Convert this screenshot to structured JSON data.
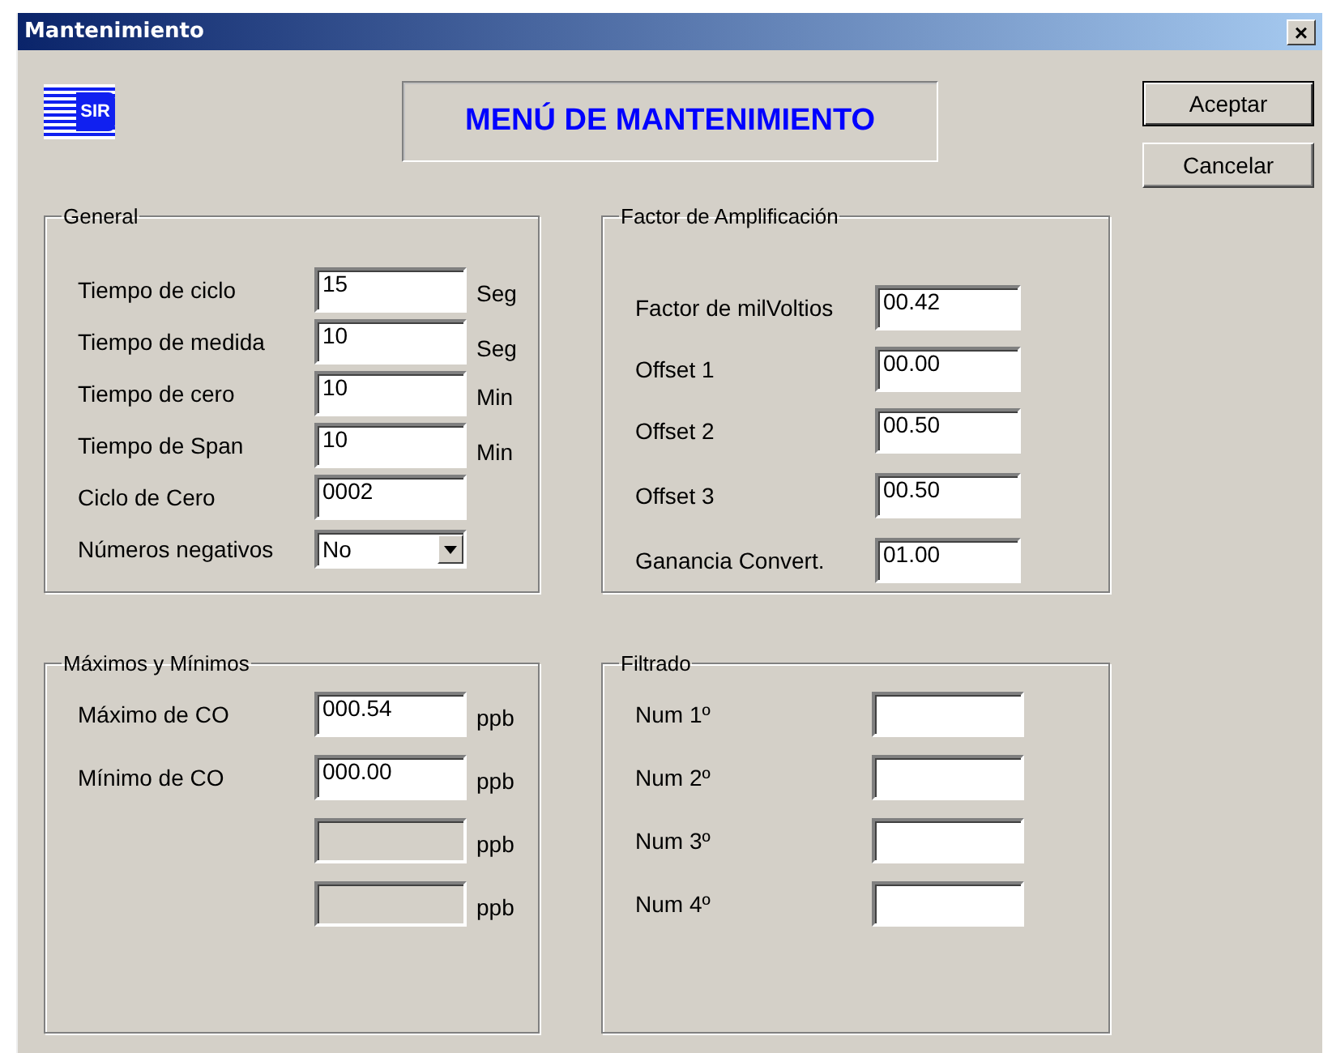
{
  "window": {
    "title": "Mantenimiento",
    "close": "×"
  },
  "logo": {
    "text": "SIR"
  },
  "heading": "MENÚ DE MANTENIMIENTO",
  "buttons": [
    {
      "label": "Aceptar",
      "default": true
    },
    {
      "label": "Cancelar",
      "default": false
    }
  ],
  "groups": [
    {
      "title": "General",
      "rows": [
        {
          "kind": "text",
          "label": "Tiempo de ciclo",
          "value": "15",
          "unit": "Seg",
          "disabled": false
        },
        {
          "kind": "text",
          "label": "Tiempo de medida",
          "value": "10",
          "unit": "Seg",
          "disabled": false
        },
        {
          "kind": "text",
          "label": "Tiempo de cero",
          "value": "10",
          "unit": "Min",
          "disabled": false
        },
        {
          "kind": "text",
          "label": "Tiempo de Span",
          "value": "10",
          "unit": "Min",
          "disabled": false
        },
        {
          "kind": "text",
          "label": "Ciclo de Cero",
          "value": "0002",
          "disabled": false
        },
        {
          "kind": "select",
          "label": "Números negativos",
          "value": "No",
          "disabled": false
        }
      ]
    },
    {
      "title": "Factor de Amplificación",
      "rows": [
        {
          "kind": "text",
          "label": "Factor de milVoltios",
          "value": "00.42",
          "disabled": false
        },
        {
          "kind": "text",
          "label": "Offset 1",
          "value": "00.00",
          "disabled": false
        },
        {
          "kind": "text",
          "label": "Offset 2",
          "value": "00.50",
          "disabled": false
        },
        {
          "kind": "text",
          "label": "Offset 3",
          "value": "00.50",
          "disabled": false
        },
        {
          "kind": "text",
          "label": "Ganancia Convert.",
          "value": "01.00",
          "disabled": false
        }
      ]
    },
    {
      "title": "Máximos y Mínimos",
      "rows": [
        {
          "kind": "text",
          "label": "Máximo de CO",
          "value": "000.54",
          "unit": "ppb",
          "disabled": false
        },
        {
          "kind": "text",
          "label": "Mínimo de CO",
          "value": "000.00",
          "unit": "ppb",
          "disabled": false
        },
        {
          "kind": "text",
          "unit": "ppb",
          "disabled": true
        },
        {
          "kind": "text",
          "unit": "ppb",
          "disabled": true
        }
      ]
    },
    {
      "title": "Filtrado",
      "rows": [
        {
          "kind": "text",
          "label": "Num 1º",
          "disabled": false
        },
        {
          "kind": "text",
          "label": "Num 2º",
          "disabled": false
        },
        {
          "kind": "text",
          "label": "Num 3º",
          "disabled": false
        },
        {
          "kind": "text",
          "label": "Num 4º",
          "disabled": false
        }
      ]
    }
  ]
}
